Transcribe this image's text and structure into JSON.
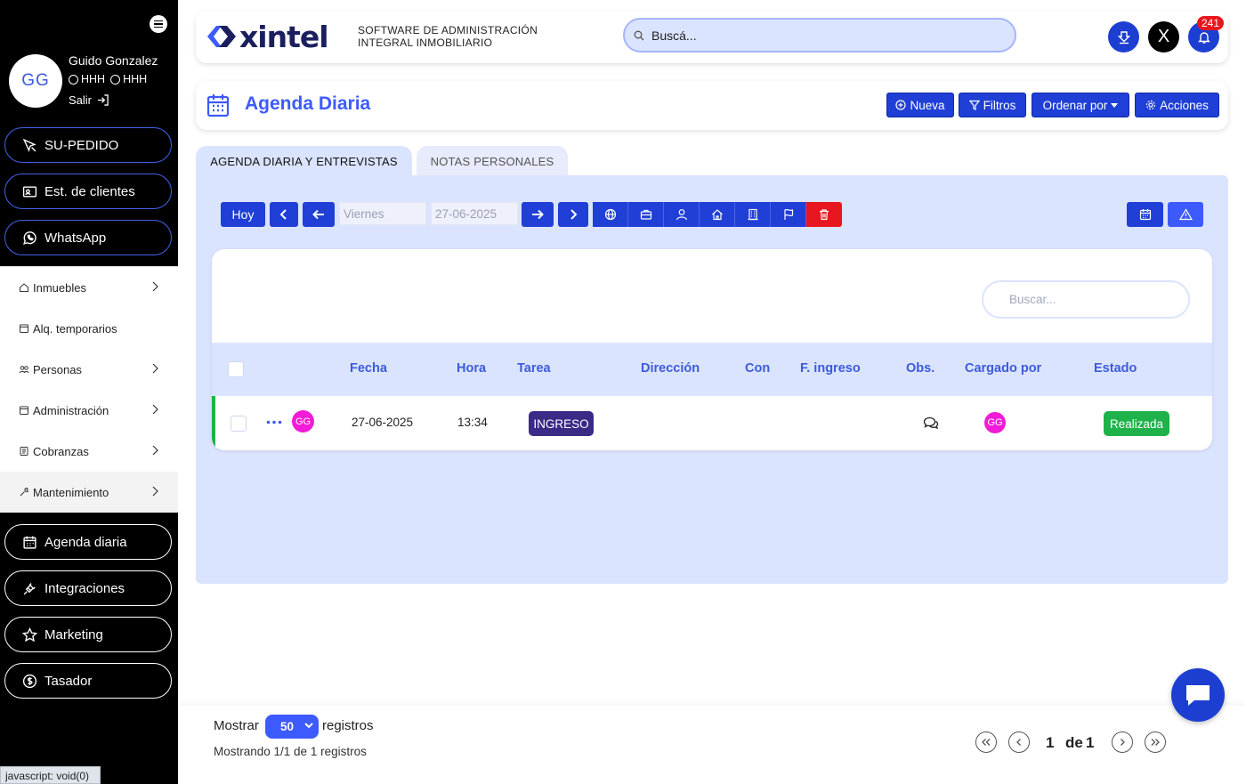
{
  "sidebar": {
    "user": {
      "initials": "GG",
      "name": "Guido Gonzalez",
      "tag1": "HHH",
      "tag2": "HHH",
      "logout": "Salir"
    },
    "top_buttons": [
      {
        "label": "SU-PEDIDO",
        "icon": "cursor-icon"
      },
      {
        "label": "Est. de clientes",
        "icon": "id-card-icon"
      },
      {
        "label": "WhatsApp",
        "icon": "whatsapp-icon"
      }
    ],
    "nav": [
      {
        "label": "Inmuebles",
        "icon": "house-icon",
        "has_submenu": true
      },
      {
        "label": "Alq. temporarios",
        "icon": "calendar-icon",
        "has_submenu": false
      },
      {
        "label": "Personas",
        "icon": "people-icon",
        "has_submenu": true
      },
      {
        "label": "Administración",
        "icon": "calendar-icon",
        "has_submenu": true
      },
      {
        "label": "Cobranzas",
        "icon": "receipt-icon",
        "has_submenu": true
      },
      {
        "label": "Mantenimiento",
        "icon": "wrench-icon",
        "has_submenu": true
      }
    ],
    "bottom_buttons": [
      {
        "label": "Agenda diaria",
        "icon": "calendar-icon"
      },
      {
        "label": "Integraciones",
        "icon": "plug-icon"
      },
      {
        "label": "Marketing",
        "icon": "star-icon"
      },
      {
        "label": "Tasador",
        "icon": "dollar-circle-icon"
      }
    ],
    "status_text": "javascript: void(0)"
  },
  "header": {
    "logo_text": "xintel",
    "tagline_line1": "SOFTWARE DE ADMINISTRACIÓN",
    "tagline_line2": "INTEGRAL INMOBILIARIO",
    "search_placeholder": "Buscá...",
    "x_button": "X",
    "notification_count": "241"
  },
  "page": {
    "title": "Agenda Diaria",
    "actions": {
      "new": "Nueva",
      "filters": "Filtros",
      "sort": "Ordenar por",
      "actions": "Acciones"
    }
  },
  "tabs": [
    {
      "label": "AGENDA DIARIA Y ENTREVISTAS",
      "active": true
    },
    {
      "label": "NOTAS PERSONALES",
      "active": false
    }
  ],
  "toolbar": {
    "today": "Hoy",
    "day_name": "Viernes",
    "date": "27-06-2025"
  },
  "table": {
    "search_placeholder": "Buscar...",
    "columns": [
      "Fecha",
      "Hora",
      "Tarea",
      "Dirección",
      "Con",
      "F. ingreso",
      "Obs.",
      "Cargado por",
      "Estado"
    ],
    "rows": [
      {
        "avatar": "GG",
        "fecha": "27-06-2025",
        "hora": "13:34",
        "tarea": "INGRESO",
        "direccion": "",
        "con": "",
        "f_ingreso": "",
        "cargado_por": "GG",
        "estado": "Realizada"
      }
    ]
  },
  "footer": {
    "show_label": "Mostrar",
    "page_size": "50",
    "records_label": "registros",
    "showing_text": "Mostrando 1/1 de 1 registros",
    "current_page": "1",
    "of_label": "de",
    "total_pages": "1"
  },
  "colors": {
    "primary": "#1f3fd6",
    "accent": "#3d5afe",
    "panel": "#dbe4ff",
    "success": "#1fb24a",
    "danger": "#e8161e",
    "avatar": "#f21bd7"
  }
}
